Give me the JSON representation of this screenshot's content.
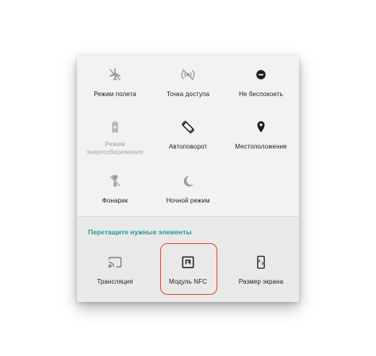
{
  "quick_settings": {
    "active_tiles": [
      {
        "label": "Режим полета",
        "icon": "airplane-off-icon",
        "state": "off"
      },
      {
        "label": "Точка доступа",
        "icon": "hotspot-off-icon",
        "state": "off"
      },
      {
        "label": "Не беспокоить",
        "icon": "do-not-disturb-icon",
        "state": "on"
      },
      {
        "label": "Режим энергосбережения",
        "icon": "battery-saver-icon",
        "state": "disabled"
      },
      {
        "label": "Автоповорот",
        "icon": "auto-rotate-icon",
        "state": "on"
      },
      {
        "label": "Местоположение",
        "icon": "location-icon",
        "state": "on"
      },
      {
        "label": "Фонарик",
        "icon": "flashlight-off-icon",
        "state": "off"
      },
      {
        "label": "Ночной режим",
        "icon": "night-mode-icon",
        "state": "off"
      }
    ],
    "drag_section_title": "Перетащите нужные элементы",
    "available_tiles": [
      {
        "label": "Трансляция",
        "icon": "cast-icon"
      },
      {
        "label": "Модуль NFC",
        "icon": "nfc-icon",
        "highlighted": true
      },
      {
        "label": "Размер экрана",
        "icon": "screen-size-icon"
      }
    ]
  },
  "colors": {
    "accent_teal": "#1f9e8e",
    "highlight_red": "#e04a2a",
    "panel_bg": "#f0f0f0",
    "icon_on": "#1f1f1f",
    "icon_off": "#9a9a9a"
  }
}
